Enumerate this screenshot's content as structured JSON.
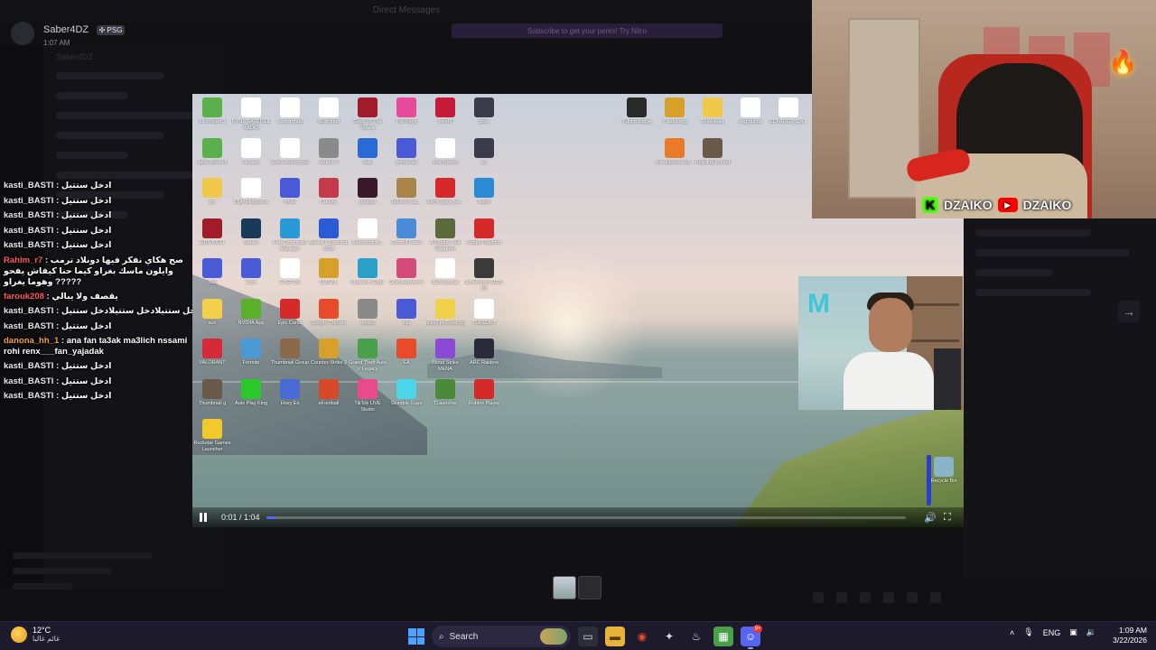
{
  "dm": {
    "name": "Saber4DZ",
    "tag": "✣ PSG",
    "time": "1:07 AM"
  },
  "background": {
    "top_title": "Direct Messages",
    "banner": "Subscribe to get your perks! Try Nitro",
    "channel_header": "Saber4DZ"
  },
  "chat": [
    {
      "user": "kasti_BASTI",
      "text": "ادخل ستتيل",
      "color": "#e8e8ee"
    },
    {
      "user": "kasti_BASTI",
      "text": "ادخل ستتيل",
      "color": "#e8e8ee"
    },
    {
      "user": "kasti_BASTI",
      "text": "ادخل ستتيل",
      "color": "#e8e8ee"
    },
    {
      "user": "kasti_BASTI",
      "text": "ادخل ستتيل",
      "color": "#e8e8ee"
    },
    {
      "user": "kasti_BASTI",
      "text": "ادخل ستتيل",
      "color": "#e8e8ee"
    },
    {
      "user": "Rahim_r7",
      "text": "صح هكاي نفكر فيها دونلاد ترمب وايلون ماسك بغراو كيما حنا كيفاش يفحو وهوما يغراو ?????",
      "color": "#ff5a5a",
      "multi": true
    },
    {
      "user": "farouk208",
      "text": "يقصف ولا يبالي",
      "color": "#ff5a5a"
    },
    {
      "user": "kasti_BASTI",
      "text": "ادخل ستتيلادخل ستتيلادخل ستتيلادخل ستتيل",
      "color": "#e8e8ee"
    },
    {
      "user": "kasti_BASTI",
      "text": "ادخل ستتيل",
      "color": "#e8e8ee"
    },
    {
      "user": "danona_hh_1",
      "text": "ana fan ta3ak ma3lich nssami rohi renx___fan_yajadak",
      "color": "#f2a04a",
      "multi": true
    },
    {
      "user": "kasti_BASTI",
      "text": "ادخل ستتيل",
      "color": "#e8e8ee"
    },
    {
      "user": "kasti_BASTI",
      "text": "ادخل ستتيل",
      "color": "#e8e8ee"
    },
    {
      "user": "kasti_BASTI",
      "text": "ادخل ستتيل",
      "color": "#e8e8ee"
    }
  ],
  "desktop_icons": [
    {
      "label": "Mini Rush 3",
      "color": "#5ab04a"
    },
    {
      "label": "NYNX SAVEFILE RADIO",
      "color": "#ffffff"
    },
    {
      "label": "x.txt.cryhud",
      "color": "#ffffff"
    },
    {
      "label": "8k.cryhud",
      "color": "#ffffff"
    },
    {
      "label": "Gods Of The Forest",
      "color": "#a01c2a"
    },
    {
      "label": "Full Keys",
      "color": "#e84a9a"
    },
    {
      "label": "FiveM",
      "color": "#c41c3a"
    },
    {
      "label": "pcsx",
      "color": "#3a3a4a"
    },
    {
      "label": "Java Studio 5",
      "color": "#5ab04a"
    },
    {
      "label": "9k.sssy",
      "color": "#ffffff"
    },
    {
      "label": "pcsx2.hud.cryhud",
      "color": "#ffffff"
    },
    {
      "label": "source 2",
      "color": "#8a8a8a"
    },
    {
      "label": "valo",
      "color": "#2a6ad6"
    },
    {
      "label": "advanced",
      "color": "#4a5ad6"
    },
    {
      "label": "obs.cryhud",
      "color": "#ffffff"
    },
    {
      "label": "pc",
      "color": "#3a3a4a"
    },
    {
      "label": "pc",
      "color": "#f2c84a"
    },
    {
      "label": "OpenHogwarts",
      "color": "#ffffff"
    },
    {
      "label": "Invite",
      "color": "#4a5ad6"
    },
    {
      "label": "UniKey",
      "color": "#c43a4a"
    },
    {
      "label": "poppy2",
      "color": "#3a1a2a"
    },
    {
      "label": "back-for-up...",
      "color": "#a8864a"
    },
    {
      "label": "frame grey_be...",
      "color": "#d62a2a"
    },
    {
      "label": "fluent",
      "color": "#2a8ad6"
    },
    {
      "label": "EDIVIDEO",
      "color": "#a01c2a"
    },
    {
      "label": "Steam",
      "color": "#1a3a5a"
    },
    {
      "label": "Free Download Manager",
      "color": "#2a9ad6"
    },
    {
      "label": "Adobe Photoshop 2024",
      "color": "#2a5ad6"
    },
    {
      "label": "videocraftcry...",
      "color": "#ffffff"
    },
    {
      "label": "Control Panel",
      "color": "#4a8ad6"
    },
    {
      "label": "A Plague Tale Requiem",
      "color": "#5a6a3a"
    },
    {
      "label": "Poppy Playtime",
      "color": "#d62a2a"
    },
    {
      "label": "dad",
      "color": "#4a5ad6"
    },
    {
      "label": "slion",
      "color": "#4a5ad6"
    },
    {
      "label": "EYEPOS",
      "color": "#ffffff"
    },
    {
      "label": "SMSWL",
      "color": "#d6a02a"
    },
    {
      "label": "Microsoft Edge",
      "color": "#2aa0c8"
    },
    {
      "label": "Grab Anywhere",
      "color": "#d64a7a"
    },
    {
      "label": "dad.veg.bak",
      "color": "#ffffff"
    },
    {
      "label": "Screenshot 2026-02",
      "color": "#3a3a3a"
    },
    {
      "label": "sun",
      "color": "#f2d04a"
    },
    {
      "label": "NVIDIA App",
      "color": "#5ab02a"
    },
    {
      "label": "Epic Cards",
      "color": "#d62a2a"
    },
    {
      "label": "Google Chrome",
      "color": "#e84a2a"
    },
    {
      "label": "nvusdl",
      "color": "#8a8a8a"
    },
    {
      "label": "zila",
      "color": "#4a5ad6"
    },
    {
      "label": "pcsx2.ps2.hud.cryhud",
      "color": "#f2d04a"
    },
    {
      "label": "TEKKEN 7",
      "color": "#ffffff"
    },
    {
      "label": "VALORANT",
      "color": "#d62a3a"
    },
    {
      "label": "Fortnite",
      "color": "#4a9ad6"
    },
    {
      "label": "Thumbnail Group",
      "color": "#8a6a4a"
    },
    {
      "label": "Counter-Strike 2",
      "color": "#d6a02a"
    },
    {
      "label": "Grand Theft Auto V Legacy",
      "color": "#4aa04a"
    },
    {
      "label": "EA",
      "color": "#e84a2a"
    },
    {
      "label": "Blood Strike MENA",
      "color": "#8a4ad6"
    },
    {
      "label": "ARC Raiders",
      "color": "#2a2a3a"
    },
    {
      "label": "Thumbnail g",
      "color": "#6a5a4a"
    },
    {
      "label": "Auto Play King",
      "color": "#2ac82a"
    },
    {
      "label": "Hoxy Ex",
      "color": "#4a6ad6"
    },
    {
      "label": "eFootball",
      "color": "#d64a2a"
    },
    {
      "label": "TikTok LIVE Studio",
      "color": "#e84a8a"
    },
    {
      "label": "Stumble Guys",
      "color": "#4ad6e8"
    },
    {
      "label": "TLauncher",
      "color": "#4a8a3a"
    },
    {
      "label": "Roblox Player",
      "color": "#d62a2a"
    },
    {
      "label": "Rockstar Games Launcher",
      "color": "#f2c82a"
    },
    {
      "label": "Y.dubs.dodge",
      "color": "#2a2a2a"
    },
    {
      "label": "Y dubs.veg",
      "color": "#d6a02a"
    },
    {
      "label": "Download",
      "color": "#f2c84a"
    },
    {
      "label": "veg.dubbs",
      "color": "#ffffff"
    },
    {
      "label": "EDIVIDEO_DN...",
      "color": "#ffffff"
    },
    {
      "label": "the ni3polo.hud...",
      "color": "#e87a2a"
    },
    {
      "label": "Readlng.cryhud",
      "color": "#6a5a4a"
    },
    {
      "label": "Recycle Bin",
      "color": "#8ab4c8"
    }
  ],
  "player": {
    "time": "0:01 / 1:04",
    "progress": 0.016
  },
  "streamer": {
    "kick_name": "DZAIKO",
    "youtube_name": "DZAIKO"
  },
  "taskbar": {
    "temp": "12°C",
    "weather_desc": "غائم غالبا",
    "search_label": "Search",
    "lang": "ENG",
    "time": "1:09 AM",
    "date": "3/22/2026",
    "discord_badge": "9+"
  }
}
